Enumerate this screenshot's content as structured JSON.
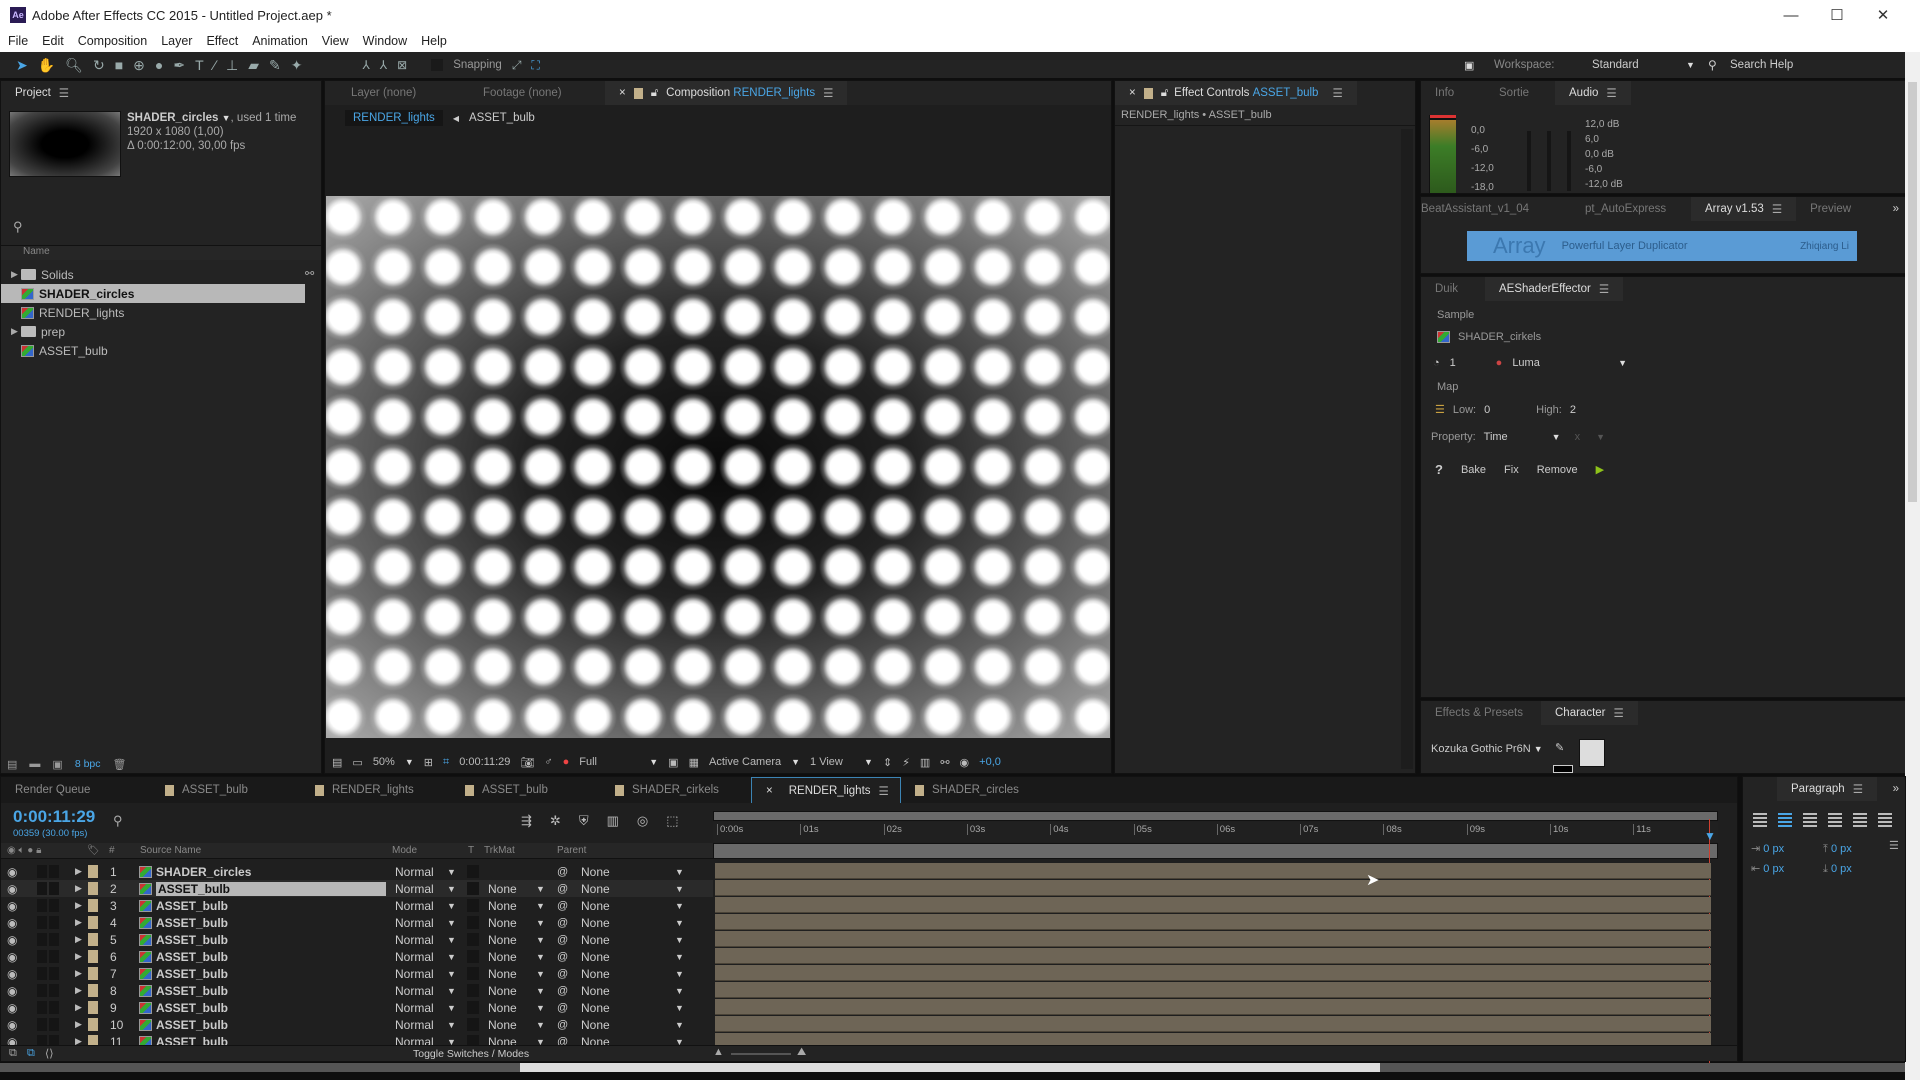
{
  "window": {
    "title": "Adobe After Effects CC 2015 - Untitled Project.aep *",
    "minimize": "—",
    "maximize": "☐",
    "close": "✕"
  },
  "menu": [
    "File",
    "Edit",
    "Composition",
    "Layer",
    "Effect",
    "Animation",
    "View",
    "Window",
    "Help"
  ],
  "toolbar": {
    "snapping": "Snapping",
    "workspace_label": "Workspace:",
    "workspace_value": "Standard",
    "search_help": "Search Help"
  },
  "project": {
    "tab": "Project",
    "selected_name": "SHADER_circles",
    "used": ", used 1 time",
    "dims": "1920 x 1080 (1,00)",
    "duration": "Δ 0:00:12:00, 30,00 fps",
    "col_name": "Name",
    "items": [
      {
        "name": "Solids",
        "type": "folder"
      },
      {
        "name": "SHADER_circles",
        "type": "comp",
        "selected": true
      },
      {
        "name": "RENDER_lights",
        "type": "comp"
      },
      {
        "name": "prep",
        "type": "folder"
      },
      {
        "name": "ASSET_bulb",
        "type": "comp"
      }
    ],
    "bpc": "8 bpc"
  },
  "viewer": {
    "tab_layer": "Layer (none)",
    "tab_footage": "Footage (none)",
    "tab_comp": "Composition",
    "comp_name": "RENDER_lights",
    "crumb_active": "RENDER_lights",
    "crumb_next": "ASSET_bulb",
    "zoom": "50%",
    "time": "0:00:11:29",
    "resolution": "Full",
    "camera": "Active Camera",
    "views": "1 View",
    "exposure": "+0,0"
  },
  "effect_controls": {
    "tab": "Effect Controls",
    "layer": "ASSET_bulb",
    "path": "RENDER_lights • ASSET_bulb"
  },
  "audio": {
    "tabs": [
      "Info",
      "Sortie",
      "Audio"
    ],
    "left_scale": [
      "0,0",
      "-6,0",
      "-12,0",
      "-18,0"
    ],
    "right_scale": [
      "12,0 dB",
      "6,0",
      "0,0 dB",
      "-6,0",
      "-12,0 dB"
    ]
  },
  "scripts": {
    "tabs": [
      "BeatAssistant_v1_04",
      "pt_AutoExpress",
      "Array v1.53",
      "Preview"
    ],
    "banner_title": "Array",
    "banner_sub": "Powerful Layer Duplicator",
    "banner_author": "Zhiqiang Li"
  },
  "shader": {
    "tabs": [
      "Duik",
      "AEShaderEffector"
    ],
    "sample_label": "Sample",
    "sample_layer": "SHADER_cirkels",
    "channel_index": "1",
    "channel": "Luma",
    "map_label": "Map",
    "low_label": "Low:",
    "low": "0",
    "high_label": "High:",
    "high": "2",
    "property_label": "Property:",
    "property": "Time",
    "x_label": "x",
    "help": "?",
    "bake": "Bake",
    "fix": "Fix",
    "remove": "Remove"
  },
  "character": {
    "tabs": [
      "Effects & Presets",
      "Character"
    ],
    "font": "Kozuka Gothic Pr6N"
  },
  "timeline": {
    "tabs": [
      "Render Queue",
      "ASSET_bulb",
      "RENDER_lights",
      "ASSET_bulb",
      "SHADER_cirkels",
      "RENDER_lights",
      "SHADER_circles"
    ],
    "active_tab": 5,
    "timecode": "0:00:11:29",
    "frames": "00359 (30.00 fps)",
    "headers": {
      "num": "#",
      "source": "Source Name",
      "mode": "Mode",
      "t": "T",
      "trkmat": "TrkMat",
      "parent": "Parent"
    },
    "ruler": [
      "0:00s",
      "01s",
      "02s",
      "03s",
      "04s",
      "05s",
      "06s",
      "07s",
      "08s",
      "09s",
      "10s",
      "11s"
    ],
    "toggle": "Toggle Switches / Modes",
    "layers": [
      {
        "n": "1",
        "name": "SHADER_circles",
        "mode": "Normal",
        "trkmat": "",
        "parent": "None"
      },
      {
        "n": "2",
        "name": "ASSET_bulb",
        "mode": "Normal",
        "trkmat": "None",
        "parent": "None",
        "selected": true
      },
      {
        "n": "3",
        "name": "ASSET_bulb",
        "mode": "Normal",
        "trkmat": "None",
        "parent": "None"
      },
      {
        "n": "4",
        "name": "ASSET_bulb",
        "mode": "Normal",
        "trkmat": "None",
        "parent": "None"
      },
      {
        "n": "5",
        "name": "ASSET_bulb",
        "mode": "Normal",
        "trkmat": "None",
        "parent": "None"
      },
      {
        "n": "6",
        "name": "ASSET_bulb",
        "mode": "Normal",
        "trkmat": "None",
        "parent": "None"
      },
      {
        "n": "7",
        "name": "ASSET_bulb",
        "mode": "Normal",
        "trkmat": "None",
        "parent": "None"
      },
      {
        "n": "8",
        "name": "ASSET_bulb",
        "mode": "Normal",
        "trkmat": "None",
        "parent": "None"
      },
      {
        "n": "9",
        "name": "ASSET_bulb",
        "mode": "Normal",
        "trkmat": "None",
        "parent": "None"
      },
      {
        "n": "10",
        "name": "ASSET_bulb",
        "mode": "Normal",
        "trkmat": "None",
        "parent": "None"
      },
      {
        "n": "11",
        "name": "ASSET_bulb",
        "mode": "Normal",
        "trkmat": "None",
        "parent": "None"
      }
    ]
  },
  "paragraph": {
    "tab": "Paragraph",
    "indent_left": "0 px",
    "indent_right": "0 px",
    "space_before": "0 px",
    "space_after": "0 px"
  },
  "colors": {
    "accent": "#4aa6e6",
    "label_tan": "#c2b08a",
    "bar": "#6e6556",
    "banner": "#5a9bd5"
  }
}
